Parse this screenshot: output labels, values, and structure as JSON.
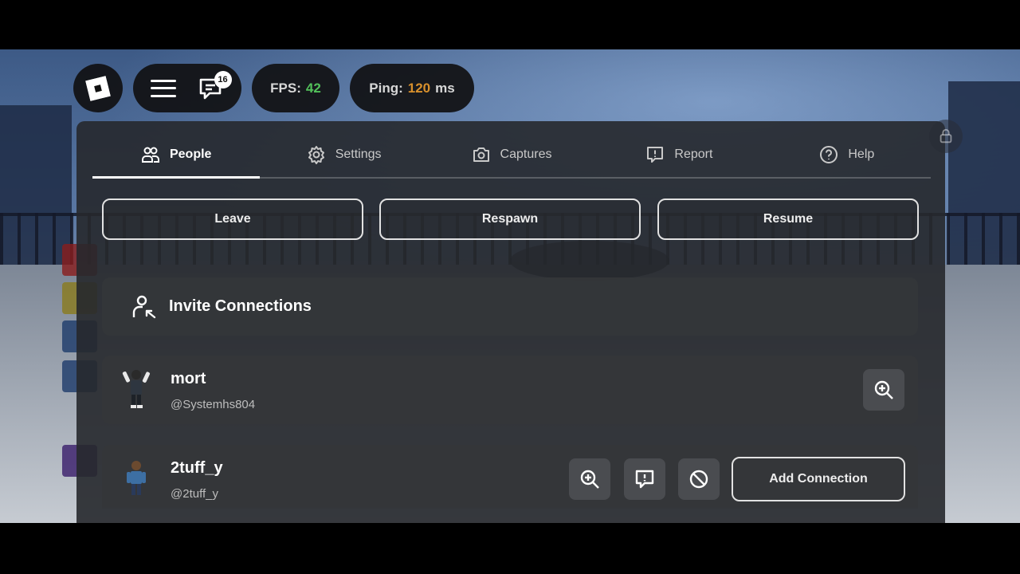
{
  "hud": {
    "chat_badge": "16",
    "fps_label": "FPS:",
    "fps_value": "42",
    "ping_label": "Ping:",
    "ping_value": "120",
    "ping_unit": "ms"
  },
  "tabs": [
    {
      "label": "People",
      "icon": "people-icon",
      "active": true
    },
    {
      "label": "Settings",
      "icon": "gear-icon",
      "active": false
    },
    {
      "label": "Captures",
      "icon": "camera-icon",
      "active": false
    },
    {
      "label": "Report",
      "icon": "report-icon",
      "active": false
    },
    {
      "label": "Help",
      "icon": "help-icon",
      "active": false
    }
  ],
  "actions": {
    "leave": "Leave",
    "respawn": "Respawn",
    "resume": "Resume"
  },
  "invite": {
    "label": "Invite Connections"
  },
  "players": [
    {
      "display_name": "mort",
      "username": "@Systemhs804"
    },
    {
      "display_name": "2tuff_y",
      "username": "@2tuff_y",
      "add_label": "Add Connection"
    }
  ],
  "colors": {
    "fps_good": "#52c15a",
    "ping_warn": "#d8902c",
    "panel": "#26282c"
  }
}
